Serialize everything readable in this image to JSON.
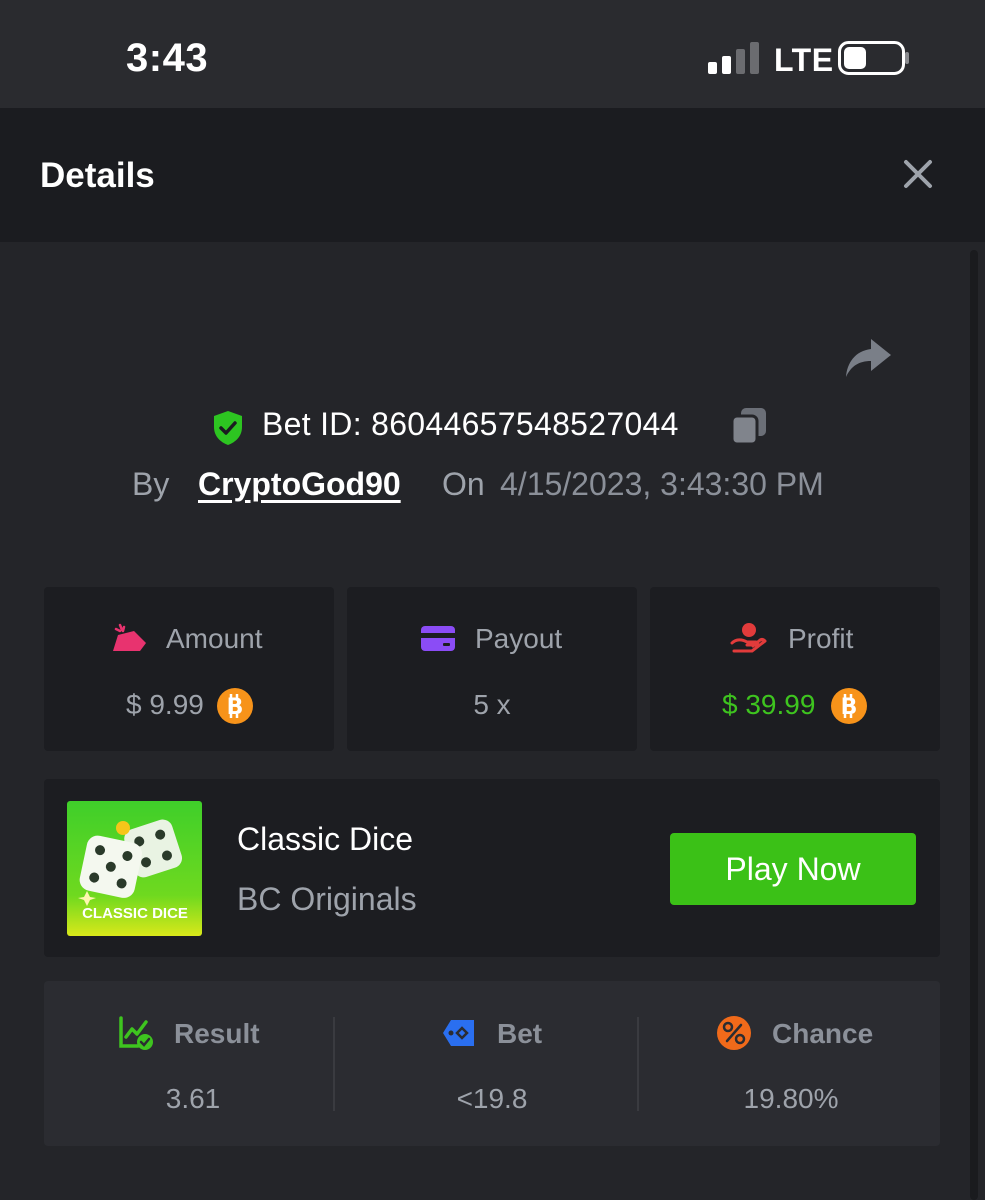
{
  "status_bar": {
    "time": "3:43",
    "network": "LTE"
  },
  "header": {
    "title": "Details"
  },
  "bet": {
    "id_text": "Bet ID: 860446575485270​44",
    "by_label": "By",
    "username": "CryptoGod90",
    "on_label": "On",
    "datetime": "4/15/2023, 3:43:30 PM"
  },
  "stats": [
    {
      "label": "Amount",
      "value": "$ 9.99",
      "icon": "amount-icon",
      "currency_icon": "bitcoin-icon"
    },
    {
      "label": "Payout",
      "value": "5 x",
      "icon": "card-icon"
    },
    {
      "label": "Profit",
      "value": "$ 39.99",
      "icon": "hand-coin-icon",
      "currency_icon": "bitcoin-icon"
    }
  ],
  "game": {
    "name": "Classic Dice",
    "provider": "BC Originals",
    "thumb_text": "CLASSIC DICE",
    "play_label": "Play Now"
  },
  "result": [
    {
      "label": "Result",
      "value": "3.61",
      "icon": "chart-check-icon"
    },
    {
      "label": "Bet",
      "value": "<19.8",
      "icon": "tag-icon"
    },
    {
      "label": "Chance",
      "value": "19.80%",
      "icon": "percent-icon"
    }
  ],
  "colors": {
    "accent_green": "#3bc117",
    "profit_green": "#3ec41f",
    "amount_pink": "#e8336f",
    "payout_purple": "#8b4cf6",
    "profit_red": "#e23b3b",
    "bet_blue": "#2a6ff0",
    "chance_orange": "#f06a1a",
    "bitcoin_orange": "#f7931a"
  }
}
